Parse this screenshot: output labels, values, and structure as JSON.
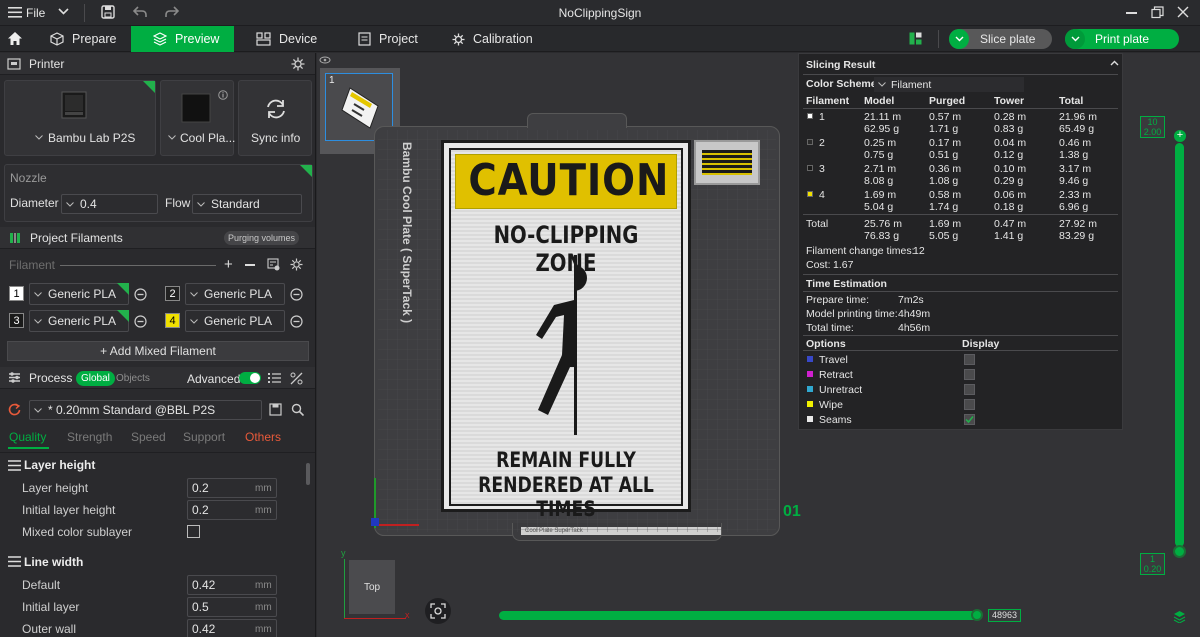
{
  "titlebar": {
    "file_label": "File",
    "title": "NoClippingSign"
  },
  "tabs": {
    "prepare": "Prepare",
    "preview": "Preview",
    "device": "Device",
    "project": "Project",
    "calibration": "Calibration",
    "slice_plate": "Slice plate",
    "print_plate": "Print plate"
  },
  "printer": {
    "header": "Printer",
    "model": "Bambu Lab P2S",
    "plate": "Cool Pla...",
    "sync": "Sync info",
    "nozzle_label": "Nozzle",
    "diameter_label": "Diameter",
    "diameter_value": "0.4",
    "flow_label": "Flow",
    "flow_value": "Standard"
  },
  "filaments": {
    "header": "Project Filaments",
    "purging_button": "Purging volumes",
    "sub_label": "Filament",
    "items": [
      {
        "num": "1",
        "name": "Generic PLA",
        "color": "#ffffff",
        "textcolor": "#000000"
      },
      {
        "num": "2",
        "name": "Generic PLA",
        "color": "#222222",
        "textcolor": "#ffffff"
      },
      {
        "num": "3",
        "name": "Generic PLA",
        "color": "#1a1a1a",
        "textcolor": "#ffffff"
      },
      {
        "num": "4",
        "name": "Generic PLA",
        "color": "#f0e000",
        "textcolor": "#000000"
      }
    ],
    "add_mixed": "+ Add Mixed Filament"
  },
  "process": {
    "header": "Process",
    "global": "Global",
    "objects": "Objects",
    "advanced": "Advanced",
    "preset": "* 0.20mm Standard @BBL P2S",
    "tabs": [
      "Quality",
      "Strength",
      "Speed",
      "Support",
      "Others"
    ]
  },
  "settings": {
    "layer_height_header": "Layer height",
    "layer_height_label": "Layer height",
    "layer_height_value": "0.2",
    "initial_layer_height_label": "Initial layer height",
    "initial_layer_height_value": "0.2",
    "mixed_color_label": "Mixed color sublayer",
    "line_width_header": "Line width",
    "default_label": "Default",
    "default_value": "0.42",
    "initial_layer_label": "Initial layer",
    "initial_layer_value": "0.5",
    "outer_wall_label": "Outer wall",
    "outer_wall_value": "0.42",
    "unit": "mm"
  },
  "viewport": {
    "thumb_number": "1",
    "plate_name": "Bambu Cool Plate ( SuperTack )",
    "plate_number": "01",
    "plate_strip_text": "Cool Plate SuperTack",
    "axis_y": "y",
    "axis_x": "x",
    "view_cube": "Top",
    "sign": {
      "caution": "CAUTION",
      "zone": "NO-CLIPPING ZONE",
      "line1": "REMAIN FULLY",
      "line2": "RENDERED AT ALL TIMES"
    },
    "layer_top": "10",
    "layer_top_z": "2.00",
    "layer_bottom": "1",
    "layer_bottom_z": "0.20",
    "move_value": "48963"
  },
  "slicing_result": {
    "title": "Slicing Result",
    "color_scheme_label": "Color Scheme",
    "color_scheme_value": "Filament",
    "columns": [
      "Filament",
      "Model",
      "Purged",
      "Tower",
      "Total"
    ],
    "rows": [
      {
        "id": "1",
        "color": "#ffffff",
        "model": [
          "21.11 m",
          "62.95 g"
        ],
        "purged": [
          "0.57 m",
          "1.71 g"
        ],
        "tower": [
          "0.28 m",
          "0.83 g"
        ],
        "total": [
          "21.96 m",
          "65.49 g"
        ]
      },
      {
        "id": "2",
        "color": "#2a2a2a",
        "model": [
          "0.25 m",
          "0.75 g"
        ],
        "purged": [
          "0.17 m",
          "0.51 g"
        ],
        "tower": [
          "0.04 m",
          "0.12 g"
        ],
        "total": [
          "0.46 m",
          "1.38 g"
        ]
      },
      {
        "id": "3",
        "color": "#1a1a1a",
        "model": [
          "2.71 m",
          "8.08 g"
        ],
        "purged": [
          "0.36 m",
          "1.08 g"
        ],
        "tower": [
          "0.10 m",
          "0.29 g"
        ],
        "total": [
          "3.17 m",
          "9.46 g"
        ]
      },
      {
        "id": "4",
        "color": "#f0e000",
        "model": [
          "1.69 m",
          "5.04 g"
        ],
        "purged": [
          "0.58 m",
          "1.74 g"
        ],
        "tower": [
          "0.06 m",
          "0.18 g"
        ],
        "total": [
          "2.33 m",
          "6.96 g"
        ]
      }
    ],
    "total_label": "Total",
    "total": {
      "model": [
        "25.76 m",
        "76.83 g"
      ],
      "purged": [
        "1.69 m",
        "5.05 g"
      ],
      "tower": [
        "0.47 m",
        "1.41 g"
      ],
      "total": [
        "27.92 m",
        "83.29 g"
      ]
    },
    "filament_change_label": "Filament change times:",
    "filament_change_value": "12",
    "cost_label": "Cost:",
    "cost_value": "1.67",
    "time_header": "Time Estimation",
    "prepare_time_label": "Prepare time:",
    "prepare_time_value": "7m2s",
    "model_time_label": "Model printing time:",
    "model_time_value": "4h49m",
    "total_time_label": "Total time:",
    "total_time_value": "4h56m",
    "options_header": "Options",
    "display_header": "Display",
    "options": [
      {
        "label": "Travel",
        "color": "#3848c8",
        "checked": false
      },
      {
        "label": "Retract",
        "color": "#d020d0",
        "checked": false
      },
      {
        "label": "Unretract",
        "color": "#30a8d0",
        "checked": false
      },
      {
        "label": "Wipe",
        "color": "#f0f000",
        "checked": false
      },
      {
        "label": "Seams",
        "color": "#e8e8e8",
        "checked": true
      }
    ]
  }
}
